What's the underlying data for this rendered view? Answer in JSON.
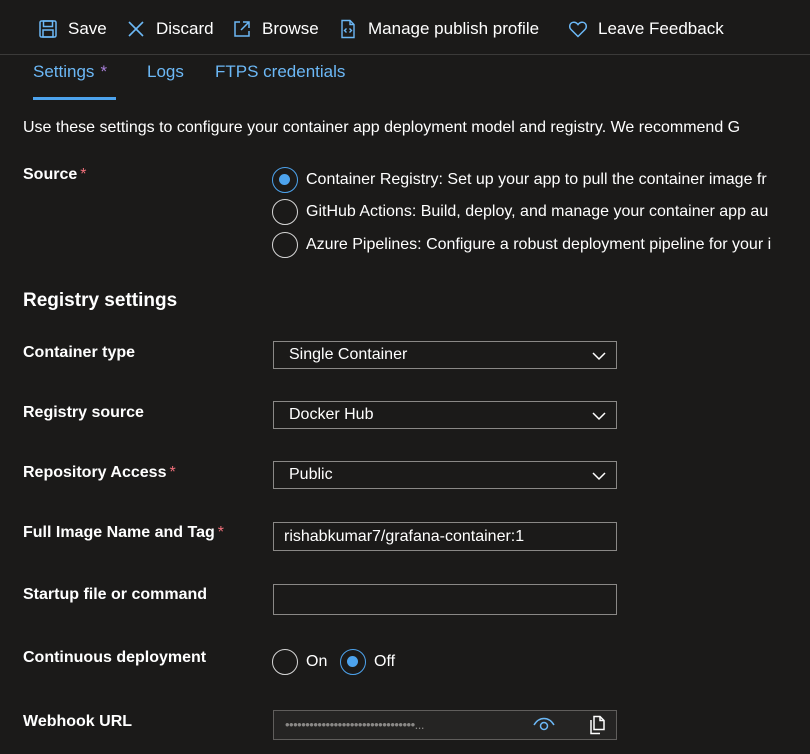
{
  "toolbar": {
    "save_label": "Save",
    "discard_label": "Discard",
    "browse_label": "Browse",
    "manage_label": "Manage publish profile",
    "feedback_label": "Leave Feedback"
  },
  "tabs": [
    {
      "label": "Settings",
      "modified_marker": "*",
      "active": true
    },
    {
      "label": "Logs"
    },
    {
      "label": "FTPS credentials"
    }
  ],
  "description": "Use these settings to configure your container app deployment model and registry. We recommend G",
  "source": {
    "label": "Source",
    "required": "*",
    "options": [
      {
        "label": "Container Registry: Set up your app to pull the container image fr",
        "checked": true
      },
      {
        "label": "GitHub Actions: Build, deploy, and manage your container app au",
        "checked": false
      },
      {
        "label": "Azure Pipelines: Configure a robust deployment pipeline for your i",
        "checked": false
      }
    ]
  },
  "registry": {
    "title": "Registry settings",
    "container_type": {
      "label": "Container type",
      "value": "Single Container"
    },
    "registry_source": {
      "label": "Registry source",
      "value": "Docker Hub"
    },
    "repository_access": {
      "label": "Repository Access",
      "required": "*",
      "value": "Public"
    },
    "image_name": {
      "label": "Full Image Name and Tag",
      "required": "*",
      "value": "rishabkumar7/grafana-container:1"
    },
    "startup": {
      "label": "Startup file or command",
      "value": ""
    },
    "continuous": {
      "label": "Continuous deployment",
      "on_label": "On",
      "off_label": "Off",
      "selected": "Off"
    },
    "webhook": {
      "label": "Webhook URL",
      "masked_value": "••••••••••••••••••••••••••••••••..."
    }
  },
  "colors": {
    "background": "#1b1a19",
    "accent": "#4da3ed",
    "link": "#6cb8f6",
    "required": "#f1707b",
    "modified": "#a77fd8"
  },
  "icons": {
    "save": "save-icon",
    "discard": "close-icon",
    "browse": "open-external-icon",
    "manage": "code-file-icon",
    "feedback": "heart-icon",
    "dropdown": "chevron-down-icon",
    "reveal": "eye-icon",
    "copy": "copy-icon"
  }
}
